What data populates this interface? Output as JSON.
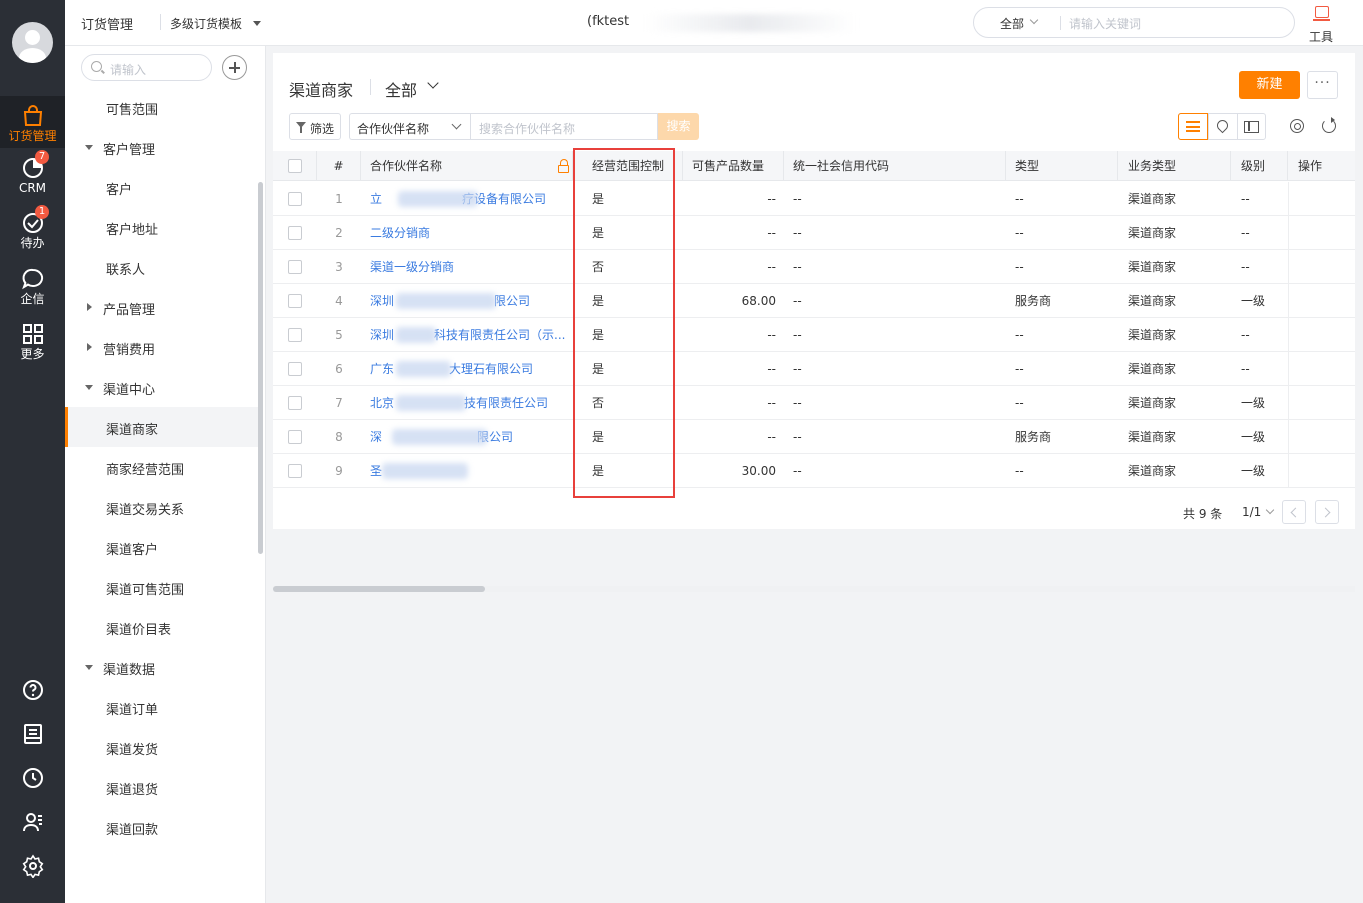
{
  "rail": {
    "items": [
      {
        "label": "订货管理",
        "icon": "shopping-bag-icon",
        "active": true
      },
      {
        "label": "CRM",
        "icon": "crm-icon",
        "badge": "7"
      },
      {
        "label": "待办",
        "icon": "todo-check-icon",
        "badge": "1"
      },
      {
        "label": "企信",
        "icon": "chat-bubble-icon"
      },
      {
        "label": "更多",
        "icon": "grid-icon"
      }
    ],
    "bottom_icons": [
      "help-icon",
      "notebook-icon",
      "clock-icon",
      "contacts-icon",
      "settings-icon"
    ]
  },
  "topbar": {
    "app_title": "订货管理",
    "template": "多级订货模板",
    "tenant": "(fktest",
    "search_scope": "全部",
    "search_placeholder": "请输入关键词",
    "tools_label": "工具"
  },
  "subnav": {
    "search_placeholder": "请输入",
    "items": [
      {
        "type": "child",
        "label": "可售范围"
      },
      {
        "type": "group",
        "label": "客户管理",
        "expanded": true
      },
      {
        "type": "child",
        "label": "客户"
      },
      {
        "type": "child",
        "label": "客户地址"
      },
      {
        "type": "child",
        "label": "联系人"
      },
      {
        "type": "group",
        "label": "产品管理",
        "expanded": false
      },
      {
        "type": "group",
        "label": "营销费用",
        "expanded": false
      },
      {
        "type": "group",
        "label": "渠道中心",
        "expanded": true
      },
      {
        "type": "child",
        "label": "渠道商家",
        "selected": true
      },
      {
        "type": "child",
        "label": "商家经营范围"
      },
      {
        "type": "child",
        "label": "渠道交易关系"
      },
      {
        "type": "child",
        "label": "渠道客户"
      },
      {
        "type": "child",
        "label": "渠道可售范围"
      },
      {
        "type": "child",
        "label": "渠道价目表"
      },
      {
        "type": "group",
        "label": "渠道数据",
        "expanded": true
      },
      {
        "type": "child",
        "label": "渠道订单"
      },
      {
        "type": "child",
        "label": "渠道发货"
      },
      {
        "type": "child",
        "label": "渠道退货"
      },
      {
        "type": "child",
        "label": "渠道回款"
      }
    ]
  },
  "main": {
    "title": "渠道商家",
    "scope": "全部",
    "new_button": "新建",
    "more_button": "···",
    "filter_button": "筛选",
    "field_select": "合作伙伴名称",
    "keyword_placeholder": "搜索合作伙伴名称",
    "search_button": "搜索",
    "columns": {
      "num": "#",
      "name": "合作伙伴名称",
      "scope": "经营范围控制",
      "qty": "可售产品数量",
      "code": "统一社会信用代码",
      "type": "类型",
      "biz": "业务类型",
      "level": "级别",
      "ops": "操作"
    },
    "rows": [
      {
        "num": "1",
        "name": "立",
        "name_tail": "疗设备有限公司",
        "scope": "是",
        "qty": "--",
        "code": "--",
        "type": "--",
        "biz": "渠道商家",
        "level": "--"
      },
      {
        "num": "2",
        "name": "二级分销商",
        "name_tail": "",
        "scope": "是",
        "qty": "--",
        "code": "--",
        "type": "--",
        "biz": "渠道商家",
        "level": "--"
      },
      {
        "num": "3",
        "name": "渠道一级分销商",
        "name_tail": "",
        "scope": "否",
        "qty": "--",
        "code": "--",
        "type": "--",
        "biz": "渠道商家",
        "level": "--"
      },
      {
        "num": "4",
        "name": "深圳",
        "name_tail": "限公司",
        "scope": "是",
        "qty": "68.00",
        "code": "--",
        "type": "服务商",
        "biz": "渠道商家",
        "level": "一级"
      },
      {
        "num": "5",
        "name": "深圳",
        "name_tail": "科技有限责任公司（示...",
        "scope": "是",
        "qty": "--",
        "code": "--",
        "type": "--",
        "biz": "渠道商家",
        "level": "--"
      },
      {
        "num": "6",
        "name": "广东",
        "name_tail": "大理石有限公司",
        "scope": "是",
        "qty": "--",
        "code": "--",
        "type": "--",
        "biz": "渠道商家",
        "level": "--"
      },
      {
        "num": "7",
        "name": "北京",
        "name_tail": "技有限责任公司",
        "scope": "否",
        "qty": "--",
        "code": "--",
        "type": "--",
        "biz": "渠道商家",
        "level": "一级"
      },
      {
        "num": "8",
        "name": "深",
        "name_tail": "限公司",
        "scope": "是",
        "qty": "--",
        "code": "--",
        "type": "服务商",
        "biz": "渠道商家",
        "level": "一级"
      },
      {
        "num": "9",
        "name": "圣",
        "name_tail": "",
        "scope": "是",
        "qty": "30.00",
        "code": "--",
        "type": "--",
        "biz": "渠道商家",
        "level": "一级"
      }
    ],
    "pager": {
      "total": "共 9 条",
      "page": "1/1"
    }
  },
  "colors": {
    "accent": "#ff8000",
    "link": "#3a7be0",
    "highlight_box": "#e8403b",
    "rail_bg": "#2b2f36"
  }
}
